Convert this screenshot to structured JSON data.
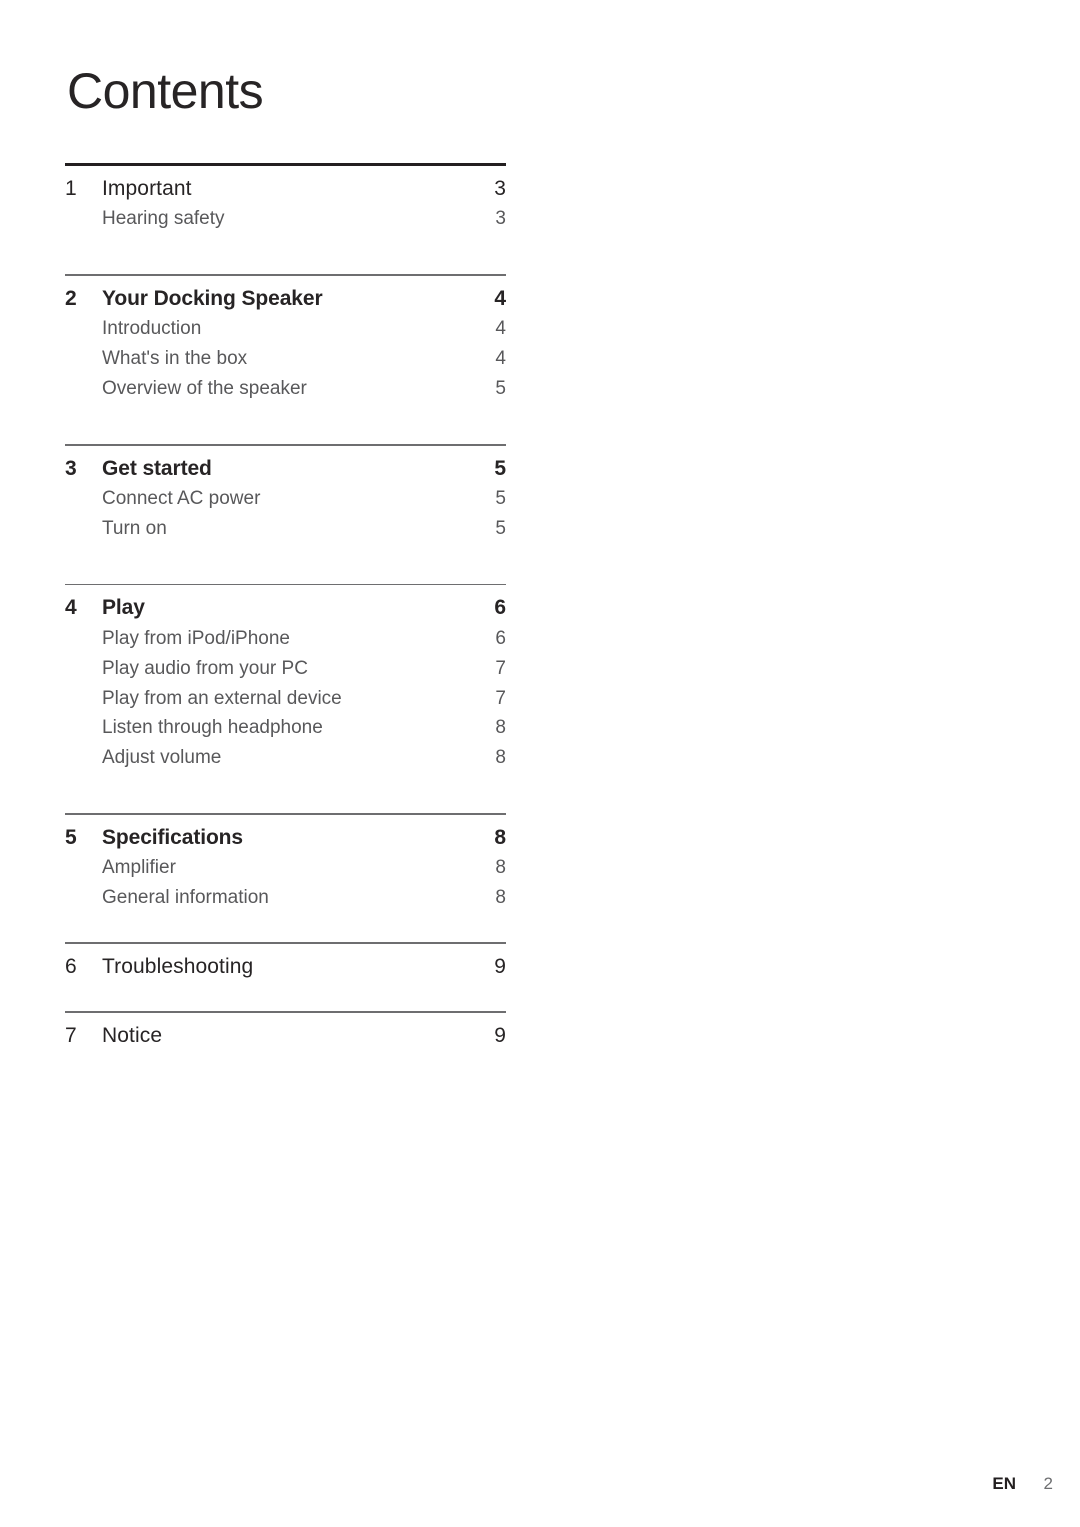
{
  "document": {
    "title": "Contents",
    "language_code": "EN",
    "page_number": "2"
  },
  "colors": {
    "heading_text": "#272425",
    "sub_text": "#58585a",
    "first_rule": "#231f20",
    "rule": "#6e6e70",
    "footer_lang": "#231f20",
    "footer_page": "#6d6e70"
  },
  "toc": {
    "sections": [
      {
        "number": "1",
        "label": "Important",
        "page": "3",
        "items": [
          {
            "label": "Hearing safety",
            "page": "3"
          }
        ]
      },
      {
        "number": "2",
        "label": "Your Docking Speaker",
        "page": "4",
        "items": [
          {
            "label": "Introduction",
            "page": "4"
          },
          {
            "label": "What's in the box",
            "page": "4"
          },
          {
            "label": "Overview of the speaker",
            "page": "5"
          }
        ]
      },
      {
        "number": "3",
        "label": "Get started",
        "page": "5",
        "items": [
          {
            "label": "Connect AC power",
            "page": "5"
          },
          {
            "label": "Turn on",
            "page": "5"
          }
        ]
      },
      {
        "number": "4",
        "label": "Play",
        "page": "6",
        "items": [
          {
            "label": "Play from iPod/iPhone",
            "page": "6"
          },
          {
            "label": "Play audio from your PC",
            "page": "7"
          },
          {
            "label": "Play from an external device",
            "page": "7"
          },
          {
            "label": "Listen through headphone",
            "page": "8"
          },
          {
            "label": "Adjust volume",
            "page": "8"
          }
        ]
      },
      {
        "number": "5",
        "label": "Specifications",
        "page": "8",
        "items": [
          {
            "label": "Amplifier",
            "page": "8"
          },
          {
            "label": "General information",
            "page": "8"
          }
        ]
      },
      {
        "number": "6",
        "label": "Troubleshooting",
        "page": "9",
        "items": []
      },
      {
        "number": "7",
        "label": "Notice",
        "page": "9",
        "items": []
      }
    ]
  }
}
